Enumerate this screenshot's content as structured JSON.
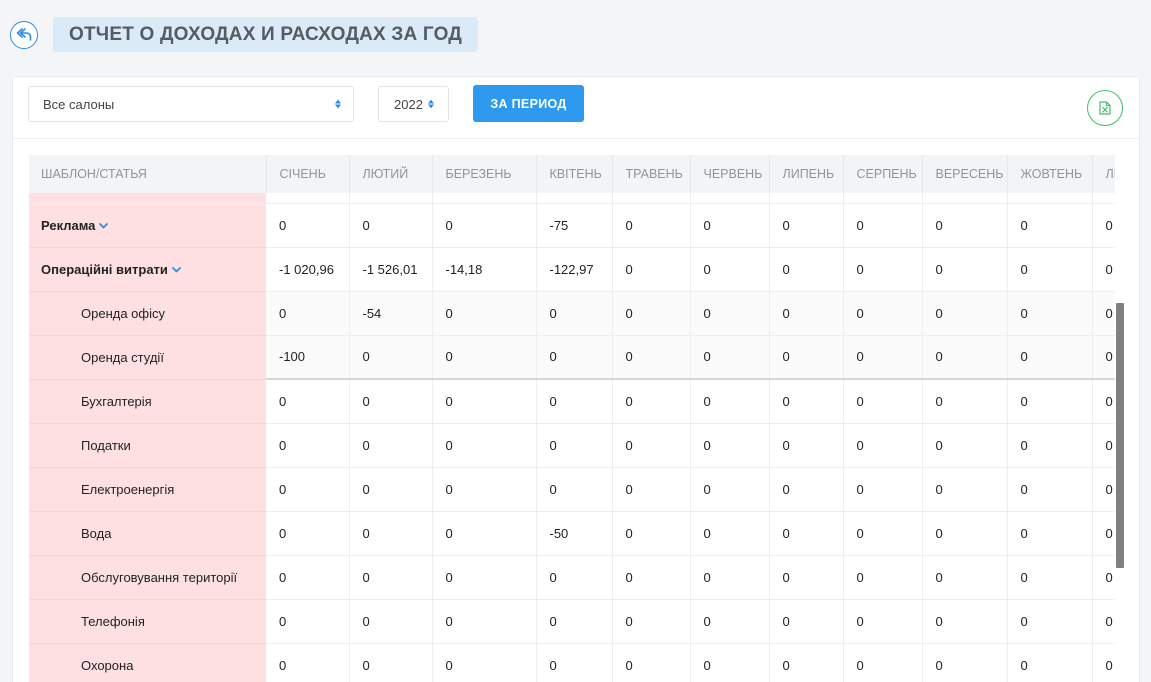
{
  "header": {
    "title": "ОТЧЕТ О ДОХОДАХ И РАСХОДАХ ЗА ГОД"
  },
  "filters": {
    "salon": "Все салоны",
    "year": "2022",
    "period_button": "ЗА ПЕРИОД"
  },
  "icons": {
    "back": "back-arrow-icon",
    "excel": "excel-file-icon",
    "chevron": "chevron-down-icon"
  },
  "colors": {
    "accent": "#2d9af0",
    "excel": "#3fbf6b",
    "label_bg": "#fee0e3"
  },
  "table": {
    "headers": [
      "ШАБЛОН/СТАТЬЯ",
      "СІЧЕНЬ",
      "ЛЮТИЙ",
      "БЕРЕЗЕНЬ",
      "КВІТЕНЬ",
      "ТРАВЕНЬ",
      "ЧЕРВЕНЬ",
      "ЛИПЕНЬ",
      "СЕРПЕНЬ",
      "ВЕРЕСЕНЬ",
      "ЖОВТЕНЬ",
      "ЛИСТОПАД"
    ],
    "rows": [
      {
        "label": "Реклама",
        "group": true,
        "values": [
          "0",
          "0",
          "0",
          "-75",
          "0",
          "0",
          "0",
          "0",
          "0",
          "0",
          "0"
        ]
      },
      {
        "label": "Операційні витрати",
        "group": true,
        "values": [
          "-1 020,96",
          "-1 526,01",
          "-14,18",
          "-122,97",
          "0",
          "0",
          "0",
          "0",
          "0",
          "0",
          "0"
        ]
      },
      {
        "label": "Оренда офісу",
        "group": false,
        "values": [
          "0",
          "-54",
          "0",
          "0",
          "0",
          "0",
          "0",
          "0",
          "0",
          "0",
          "0"
        ]
      },
      {
        "label": "Оренда студії",
        "group": false,
        "values": [
          "-100",
          "0",
          "0",
          "0",
          "0",
          "0",
          "0",
          "0",
          "0",
          "0",
          "0"
        ]
      },
      {
        "label": "Бухгалтерія",
        "group": false,
        "values": [
          "0",
          "0",
          "0",
          "0",
          "0",
          "0",
          "0",
          "0",
          "0",
          "0",
          "0"
        ]
      },
      {
        "label": "Податки",
        "group": false,
        "values": [
          "0",
          "0",
          "0",
          "0",
          "0",
          "0",
          "0",
          "0",
          "0",
          "0",
          "0"
        ]
      },
      {
        "label": "Електроенергія",
        "group": false,
        "values": [
          "0",
          "0",
          "0",
          "0",
          "0",
          "0",
          "0",
          "0",
          "0",
          "0",
          "0"
        ]
      },
      {
        "label": "Вода",
        "group": false,
        "values": [
          "0",
          "0",
          "0",
          "-50",
          "0",
          "0",
          "0",
          "0",
          "0",
          "0",
          "0"
        ]
      },
      {
        "label": "Обслуговування території",
        "group": false,
        "values": [
          "0",
          "0",
          "0",
          "0",
          "0",
          "0",
          "0",
          "0",
          "0",
          "0",
          "0"
        ]
      },
      {
        "label": "Телефонія",
        "group": false,
        "values": [
          "0",
          "0",
          "0",
          "0",
          "0",
          "0",
          "0",
          "0",
          "0",
          "0",
          "0"
        ]
      },
      {
        "label": "Охорона",
        "group": false,
        "values": [
          "0",
          "0",
          "0",
          "0",
          "0",
          "0",
          "0",
          "0",
          "0",
          "0",
          "0"
        ]
      }
    ]
  }
}
